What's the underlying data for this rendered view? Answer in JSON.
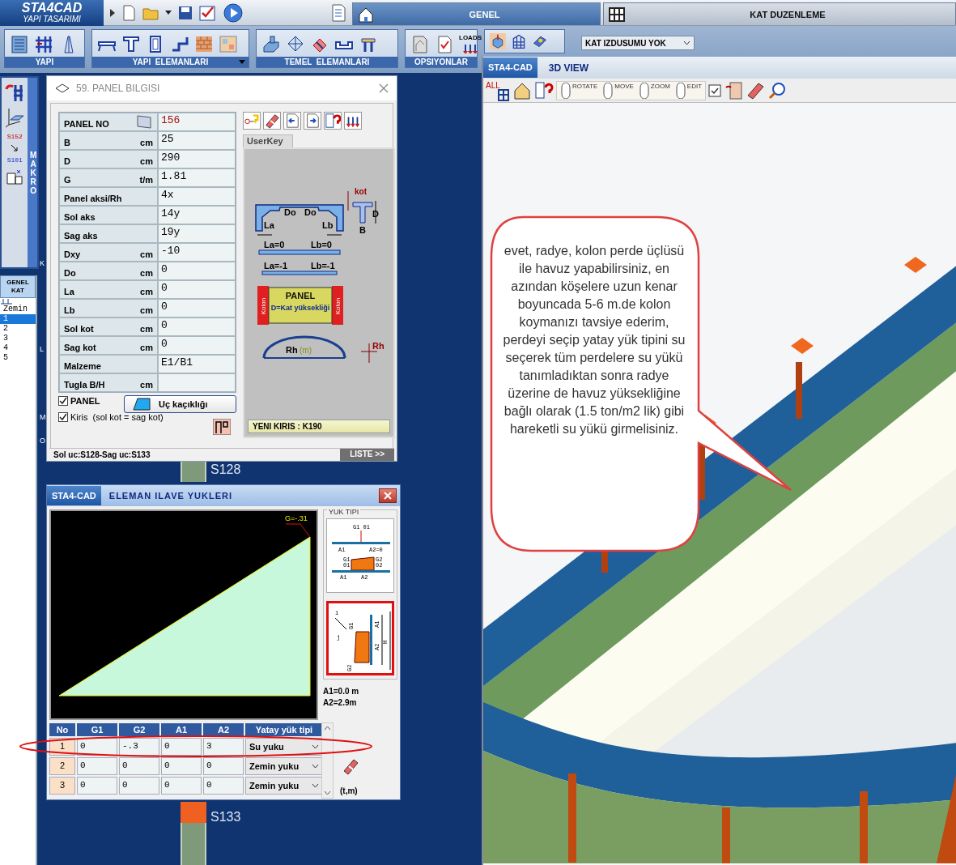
{
  "app": {
    "logo": "STA4CAD",
    "subtitle": "YAPI TASARIMI"
  },
  "tabs": [
    {
      "label": "GENEL",
      "selected": true
    },
    {
      "label": "KAT DUZENLEME",
      "selected": false
    }
  ],
  "ribbon_groups": [
    {
      "label": "YAPI",
      "menu": false
    },
    {
      "label": "YAPI  ELEMANLARI",
      "menu": true
    },
    {
      "label": "TEMEL  ELEMANLARI",
      "menu": false
    },
    {
      "label": "OPSIYONLAR",
      "menu": false,
      "icon_caption": "LOADS"
    }
  ],
  "floor_projection": {
    "value": "KAT IZDUSUMU YOK"
  },
  "macro_panel": {
    "label": "MAKRO",
    "from": "S152",
    "to": "S101"
  },
  "floor_list": {
    "header": "GENEL KAT",
    "items": [
      {
        "label": "Zemin",
        "selected": false
      },
      {
        "label": "1",
        "selected": true
      },
      {
        "label": "2",
        "selected": false
      },
      {
        "label": "3",
        "selected": false
      },
      {
        "label": "4",
        "selected": false
      },
      {
        "label": "5",
        "selected": false
      }
    ]
  },
  "axis_labels": [
    "K",
    "L",
    "M",
    "O"
  ],
  "plan_labels": [
    "S128",
    "S133"
  ],
  "panel_window": {
    "title": "59.  PANEL  BILGISI",
    "fields": [
      {
        "label": "PANEL  NO",
        "value": "156",
        "kind": "id"
      },
      {
        "label": "B",
        "unit": "cm",
        "value": "25",
        "kind": "plain"
      },
      {
        "label": "D",
        "unit": "cm",
        "value": "290",
        "kind": "plain"
      },
      {
        "label": "G",
        "unit": "t/m",
        "value": "1.81",
        "kind": "plain"
      },
      {
        "label": "Panel aksi/Rh",
        "value": "4x",
        "kind": "plain"
      },
      {
        "label": "Sol aks",
        "value": "14y",
        "kind": "plain"
      },
      {
        "label": "Sag aks",
        "value": "19y",
        "kind": "plain"
      },
      {
        "label": "Dxy",
        "unit": "cm",
        "value": "-10",
        "kind": "plain"
      },
      {
        "label": "Do",
        "unit": "cm",
        "value": "0",
        "kind": "plain"
      },
      {
        "label": "La",
        "unit": "cm",
        "value": "0",
        "kind": "plain"
      },
      {
        "label": "Lb",
        "unit": "cm",
        "value": "0",
        "kind": "plain"
      },
      {
        "label": "Sol kot",
        "unit": "cm",
        "value": "0",
        "kind": "plain"
      },
      {
        "label": "Sag kot",
        "unit": "cm",
        "value": "0",
        "kind": "plain"
      },
      {
        "label": "Malzeme",
        "value": "E1/B1",
        "kind": "plain"
      },
      {
        "label": "Tugla B/H",
        "unit": "cm",
        "kind": "plain"
      }
    ],
    "checkboxes": [
      {
        "label": "PANEL",
        "checked": true,
        "kind": "bold"
      },
      {
        "label": "Kiris  (sol kot = sag kot)",
        "checked": true,
        "kind": "normal"
      }
    ],
    "offset_button": "Uç kaçıklığı",
    "tab": "UserKey",
    "diagram": {
      "do_left": "Do",
      "do_right": "Do",
      "la": "La",
      "lb": "Lb",
      "kot": "kot",
      "d": "D",
      "b": "B",
      "la0": "La=0",
      "lb0": "Lb=0",
      "la1": "La=-1",
      "lb1": "Lb=-1",
      "panel": "PANEL",
      "panel_height": "D=Kat yüksekliği",
      "kolon_left": "Kolon",
      "kolon_right": "Kolon",
      "rh": "Rh",
      "rh_unit": "(m)",
      "rh_axis": "Rh"
    },
    "new_beam": "YENI KIRIS : K190",
    "status": "Sol uc:S128-Sag uc:S133",
    "list_button": "LISTE >>"
  },
  "load_window": {
    "brand": "STA4-CAD",
    "title": "ELEMAN ILAVE YUKLERI",
    "chart_label": "G=-.31",
    "load_type_title": "YUK TIPI",
    "load_types": [
      {
        "kind": "vertical",
        "selected": false,
        "labels": [
          "G1 01",
          "A1",
          "A2=0",
          "G1",
          "01",
          "G2",
          "02",
          "A1",
          "A2"
        ]
      },
      {
        "kind": "horizontal",
        "selected": true,
        "labels": [
          "i",
          "j",
          "G1",
          "G2",
          "A1",
          "A2",
          "H"
        ]
      }
    ],
    "a1": "A1=0.0 m",
    "a2": "A2=2.9m",
    "columns": [
      "No",
      "G1",
      "G2",
      "A1",
      "A2",
      "Yatay yük tipi"
    ],
    "rows": [
      {
        "no": "1",
        "g1": "0",
        "g2": "-.3",
        "a1": "0",
        "a2": "3",
        "type": "Su yuku"
      },
      {
        "no": "2",
        "g1": "0",
        "g2": "0",
        "a1": "0",
        "a2": "0",
        "type": "Zemin yuku"
      },
      {
        "no": "3",
        "g1": "0",
        "g2": "0",
        "a1": "0",
        "a2": "0",
        "type": "Zemin yuku"
      }
    ],
    "units": "(t,m)"
  },
  "view_window": {
    "brand": "STA4-CAD",
    "title": "3D VIEW",
    "all_caption": "ALL",
    "mouse_modes": [
      "ROTATE",
      "MOVE",
      "ZOOM",
      "EDIT"
    ],
    "callout": "evet, radye, kolon perde üçlüsü ile havuz yapabilirsiniz,   en azından köşelere  uzun kenar boyuncada 5-6 m.de kolon koymanızı tavsiye ederim, perdeyi seçip yatay yük tipini su seçerek tüm perdelere su yükü tanımladıktan sonra radye üzerine de  havuz yüksekliğine bağlı olarak (1.5 ton/m2 lik) gibi hareketli su yükü girmelisiniz."
  }
}
